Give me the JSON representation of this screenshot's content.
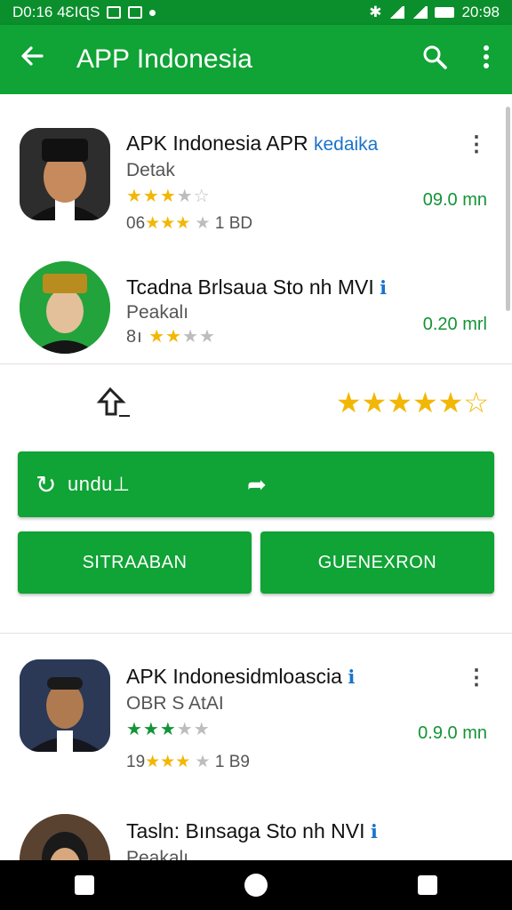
{
  "status_bar": {
    "left_text": "D0:16 4ƐIɊS",
    "time": "20:98"
  },
  "app_bar": {
    "title": "APP Indonesia"
  },
  "items": [
    {
      "name": "APK Indonesia APR",
      "tag": "kedaika",
      "subtitle": "Detak",
      "rating": 3,
      "meta": "06",
      "meta2": "1 BD",
      "size": "09.0 mn"
    },
    {
      "name": "Tcadna Brlsaua Sto nh MVI",
      "tag": "ℹ",
      "subtitle": "Peakalı",
      "rating": 2,
      "meta": "8ı",
      "size": "0.20 mrl"
    },
    {
      "name": "APK Indonesidmloascia",
      "tag": "ℹ",
      "subtitle": "OBR S AtAI",
      "rating": 3,
      "meta": "19",
      "meta2": "1 B9",
      "size": "0.9.0 mn"
    },
    {
      "name": "Tasln: Bınsaga Sto nh NVI",
      "tag": "ℹ",
      "subtitle": "Peakalı"
    }
  ],
  "actions": {
    "rating": 5,
    "download_label": "undu⊥",
    "button_left": "SITRAABAN",
    "button_right": "GUENEXRON"
  },
  "colors": {
    "primary": "#10a335",
    "status": "#0a8f2c",
    "star": "#f2b705",
    "size_text": "#139436"
  }
}
